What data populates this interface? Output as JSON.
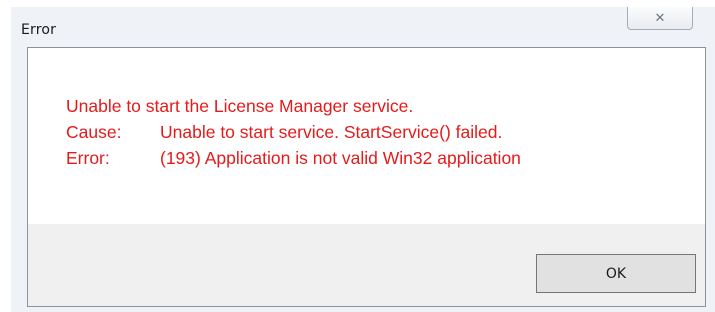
{
  "window": {
    "title": "Error",
    "close_icon": "close-icon"
  },
  "message": {
    "line1": "Unable to start the License Manager service.",
    "cause_label": "Cause:",
    "cause_text": "Unable to start service. StartService() failed.",
    "error_label": "Error:",
    "error_text": "(193) Application is not valid Win32 application",
    "text_color": "#e41b1b"
  },
  "buttons": {
    "ok_label": "OK"
  }
}
